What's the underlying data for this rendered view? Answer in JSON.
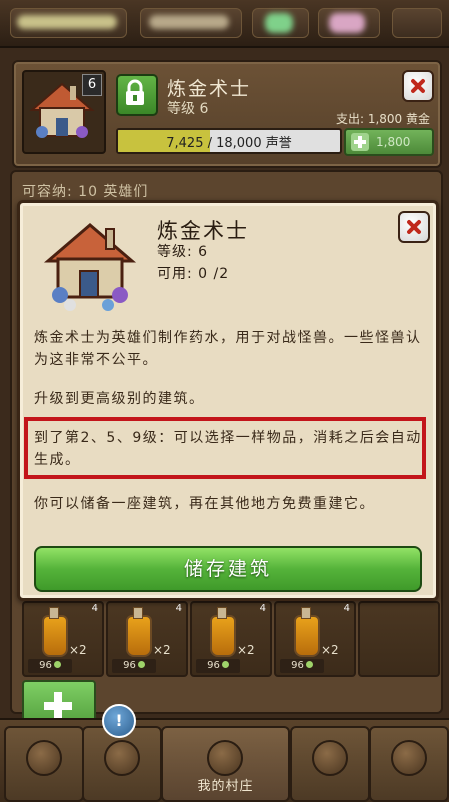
{
  "header": {
    "building_name": "炼金术士",
    "level_label": "等级 6",
    "level_badge": "6",
    "cost_label": "支出: 1,800 黄金",
    "reputation_current": "7,425",
    "reputation_text": " / 18,000 声誉",
    "reputation_progress": 0.4125,
    "upgrade_cost": "1,800"
  },
  "capacity_label": "可容纳: 10 英雄们",
  "modal": {
    "title": "炼金术士",
    "level": "等级: 6",
    "available": "可用: 0 /2",
    "description": "炼金术士为英雄们制作药水，用于对战怪兽。一些怪兽认为这非常不公平。",
    "upgrade_hint": "升级到更高级别的建筑。",
    "levels_hint": "到了第2、5、9级：可以选择一样物品，消耗之后会自动生成。",
    "store_hint": "你可以储备一座建筑，再在其他地方免费重建它。",
    "store_button": "储存建筑"
  },
  "items": [
    {
      "count": "4",
      "qty": "×2",
      "price": "96"
    },
    {
      "count": "4",
      "qty": "×2",
      "price": "96"
    },
    {
      "count": "4",
      "qty": "×2",
      "price": "96"
    },
    {
      "count": "4",
      "qty": "×2",
      "price": "96"
    }
  ],
  "nav": {
    "home_label": "我的村庄",
    "alert_glyph": "!"
  }
}
